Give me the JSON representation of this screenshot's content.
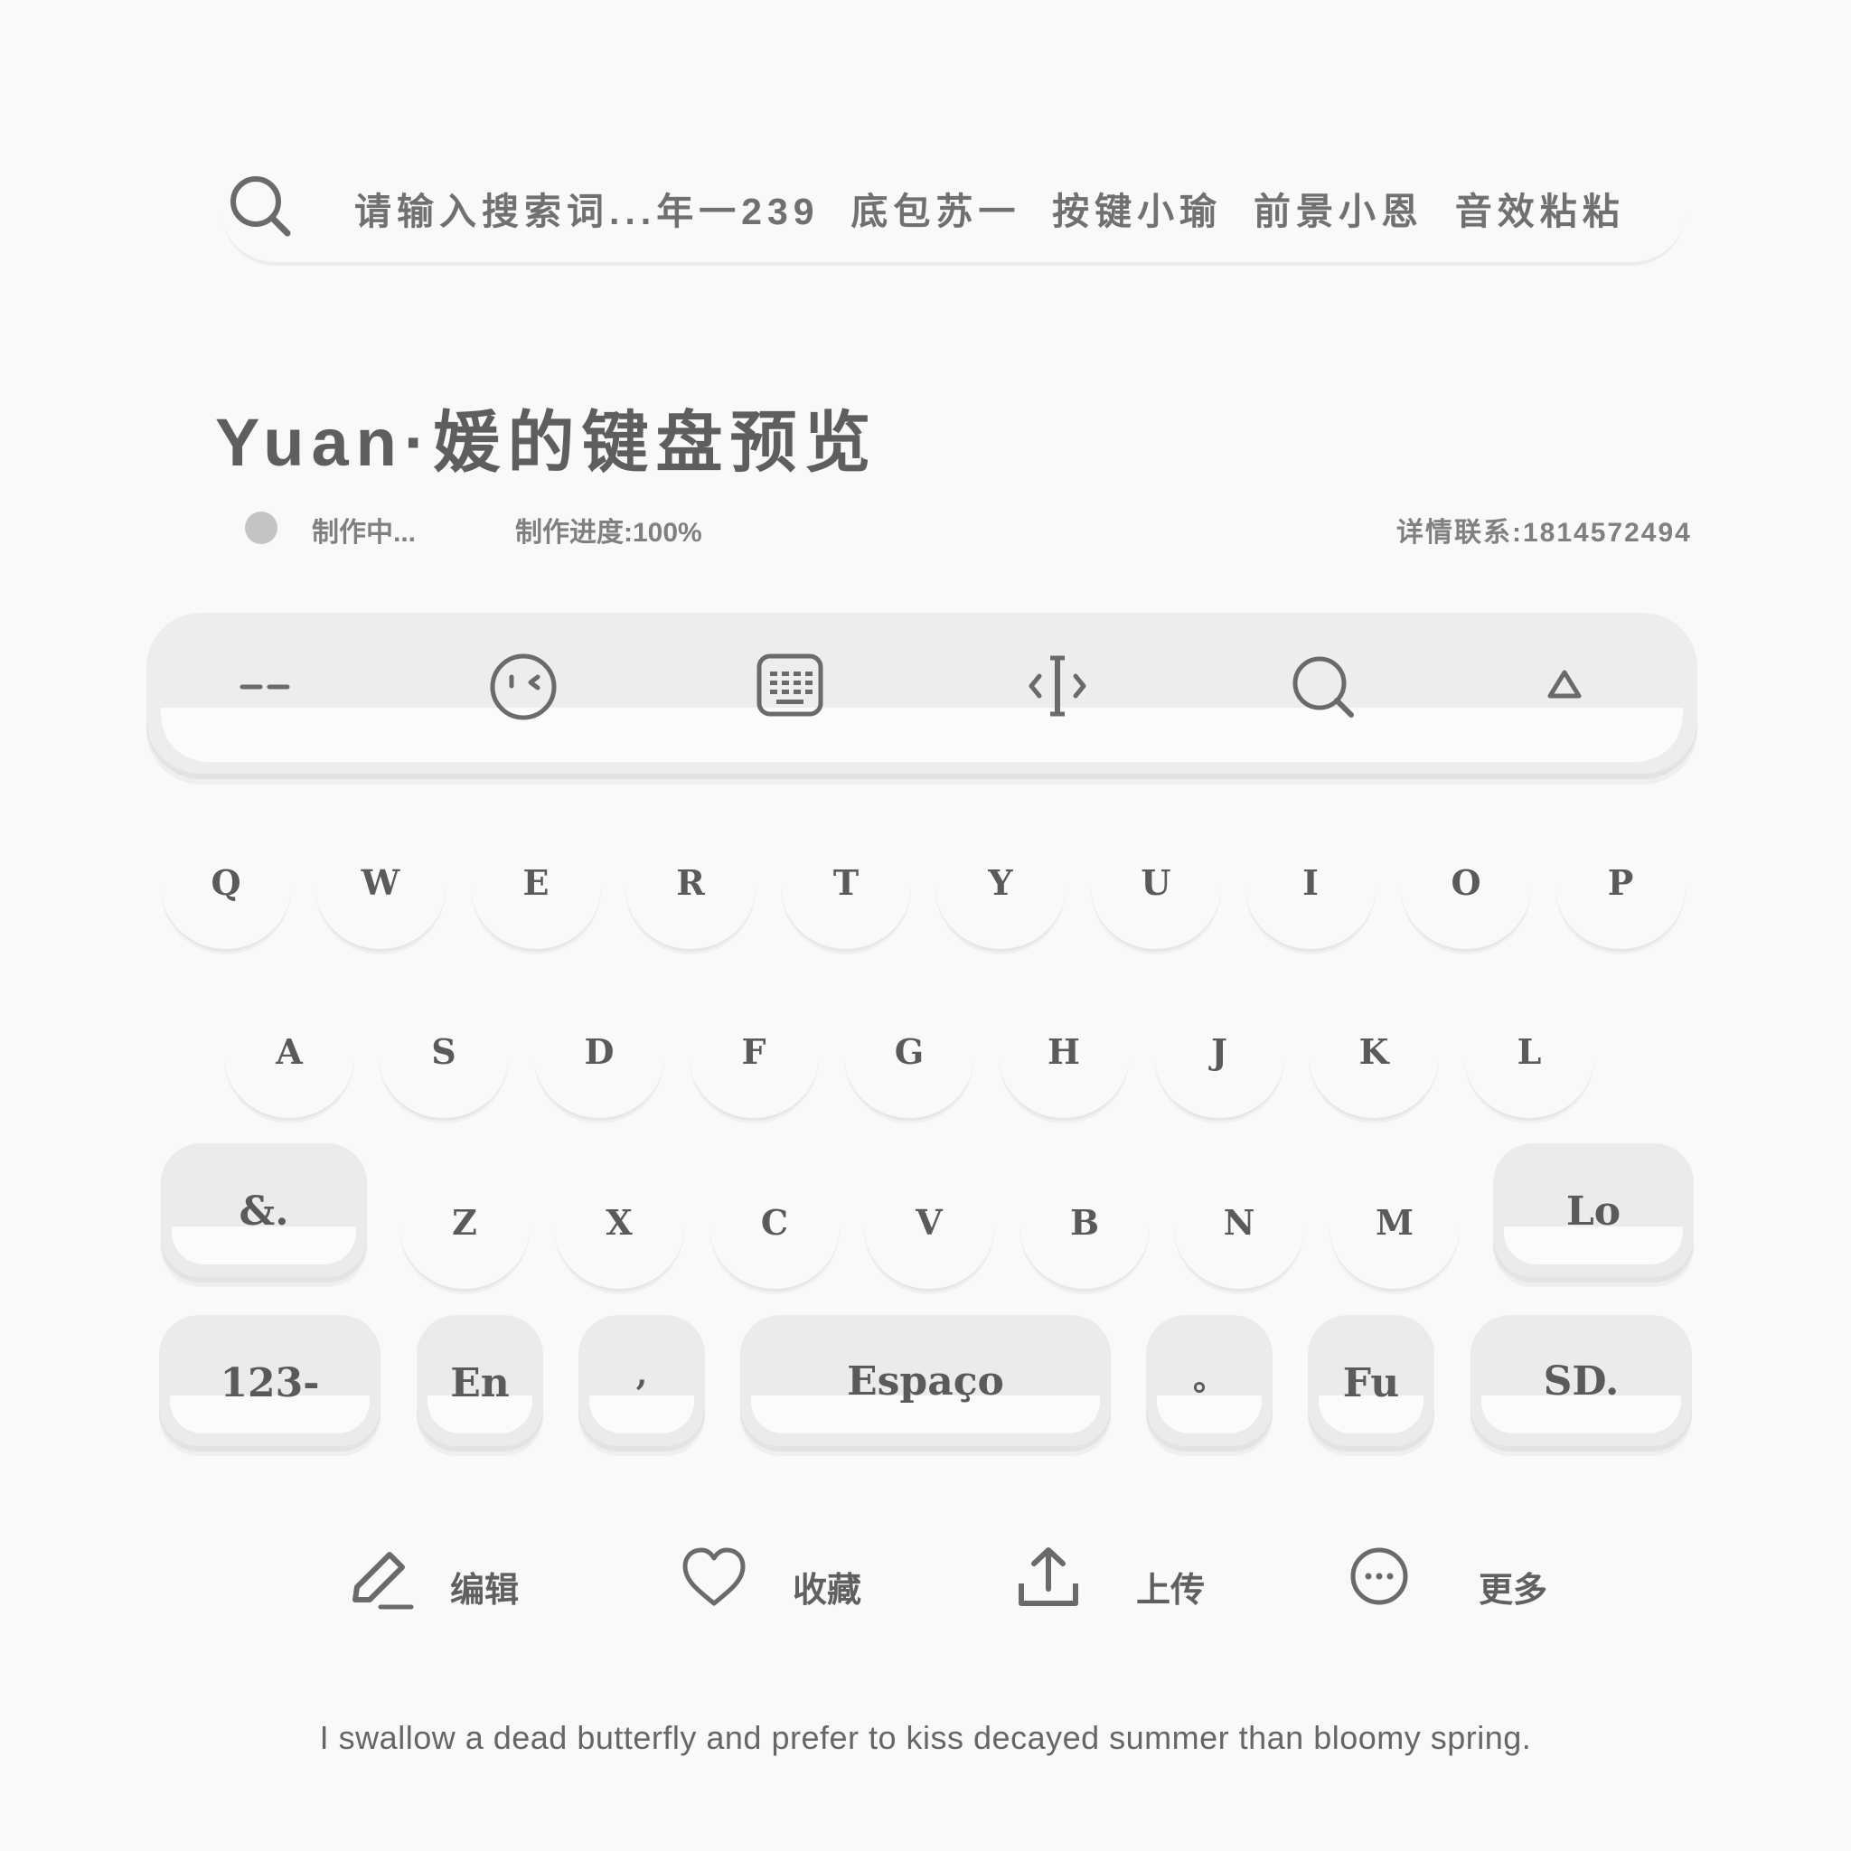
{
  "search": {
    "placeholder": "请输入搜索词...",
    "tags": "年一239  底包苏一  按键小瑜  前景小恩  音效粘粘"
  },
  "title": "Yuan·媛的键盘预览",
  "status": {
    "state": "制作中...",
    "progress_label": "制作进度:100%",
    "progress": 1.0,
    "contact": "详情联系:1814572494"
  },
  "toolbar": {
    "items": [
      {
        "name": "collapse",
        "icon": "dash-icon"
      },
      {
        "name": "emoji",
        "icon": "wink-face-icon"
      },
      {
        "name": "keyboard",
        "icon": "keyboard-icon"
      },
      {
        "name": "cursor",
        "icon": "text-cursor-icon"
      },
      {
        "name": "search",
        "icon": "search-icon"
      },
      {
        "name": "hide",
        "icon": "triangle-icon"
      }
    ]
  },
  "keyboard": {
    "row1": [
      "Q",
      "W",
      "E",
      "R",
      "T",
      "Y",
      "U",
      "I",
      "O",
      "P"
    ],
    "row2": [
      "A",
      "S",
      "D",
      "F",
      "G",
      "H",
      "J",
      "K",
      "L"
    ],
    "row3": [
      "Z",
      "X",
      "C",
      "V",
      "B",
      "N",
      "M"
    ],
    "symbols": "&.",
    "lock": "Lo",
    "numbers": "123-",
    "lang": "En",
    "comma": ",",
    "space": "Espaço",
    "period": "。",
    "fu": "Fu",
    "send": "SD."
  },
  "actions": {
    "edit": "编辑",
    "favorite": "收藏",
    "upload": "上传",
    "more": "更多"
  },
  "footer": {
    "quote": "I swallow a dead butterfly and prefer to kiss decayed summer than bloomy spring."
  },
  "colors": {
    "background": "#f9f9f9",
    "key_fill": "#ebebeb",
    "text": "#5a5a5a"
  }
}
